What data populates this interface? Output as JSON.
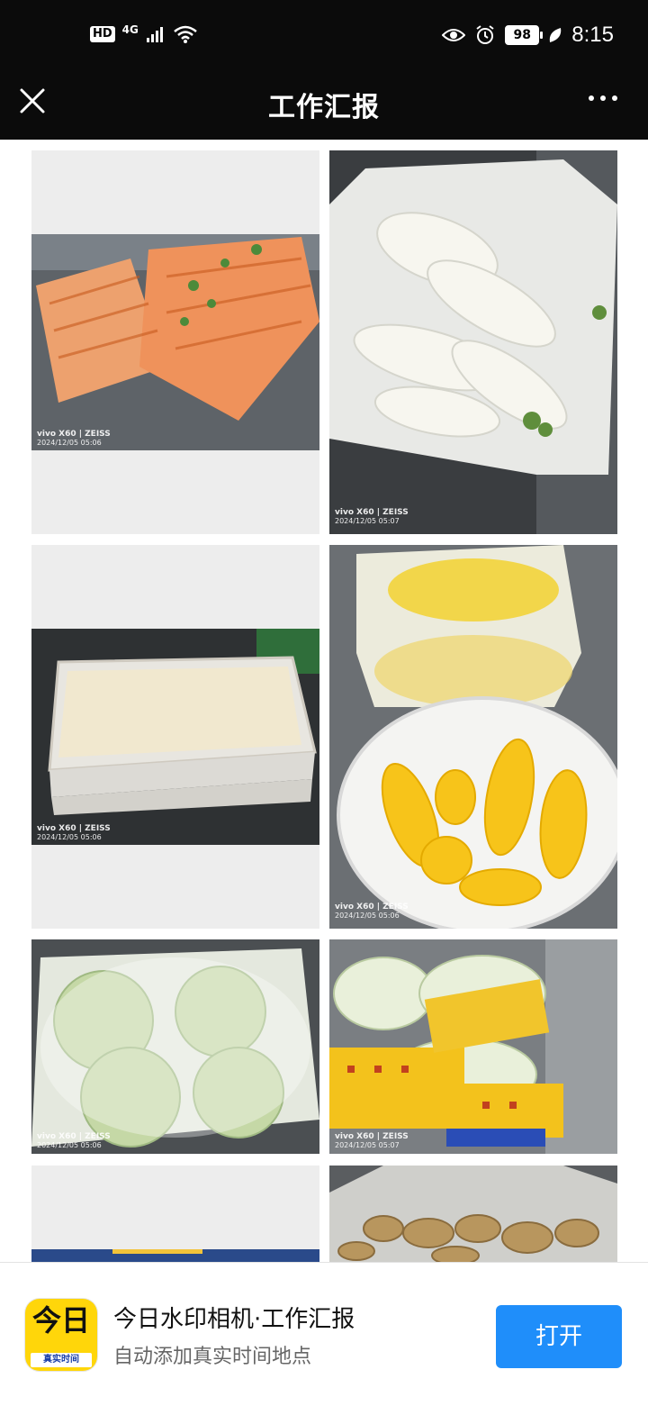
{
  "status_bar": {
    "hd_label": "HD",
    "network_label": "4G",
    "battery_level": "98",
    "time": "8:15",
    "icons": [
      "hd-icon",
      "signal-icon",
      "wifi-icon",
      "eye-icon",
      "alarm-icon",
      "battery-icon",
      "leaf-icon"
    ]
  },
  "nav": {
    "title": "工作汇报",
    "close_icon": "close-icon",
    "more_icon": "more-icon"
  },
  "photos": [
    {
      "brand": "vivo X60 | ZEISS",
      "stamp": "2024/12/05 05:06",
      "subject": "carrots"
    },
    {
      "brand": "vivo X60 | ZEISS",
      "stamp": "2024/12/05 05:07",
      "subject": "white-radish"
    },
    {
      "brand": "vivo X60 | ZEISS",
      "stamp": "2024/12/05 05:06",
      "subject": "tofu-tray"
    },
    {
      "brand": "vivo X60 | ZEISS",
      "stamp": "2024/12/05 05:06",
      "subject": "corn"
    },
    {
      "brand": "vivo X60 | ZEISS",
      "stamp": "2024/12/05 05:06",
      "subject": "cabbage"
    },
    {
      "brand": "vivo X60 | ZEISS",
      "stamp": "2024/12/05 05:07",
      "subject": "chinese-cabbage"
    },
    {
      "brand": "",
      "stamp": "",
      "subject": "partial"
    },
    {
      "brand": "",
      "stamp": "",
      "subject": "ginger"
    }
  ],
  "banner": {
    "app_icon_top": "今日",
    "app_icon_strip": "真实时间",
    "title": "今日水印相机·工作汇报",
    "subtitle": "自动添加真实时间地点",
    "open_label": "打开"
  },
  "colors": {
    "bar_bg": "#0b0b0b",
    "accent": "#1f8efa",
    "app_icon_yellow": "#ffd60a"
  }
}
